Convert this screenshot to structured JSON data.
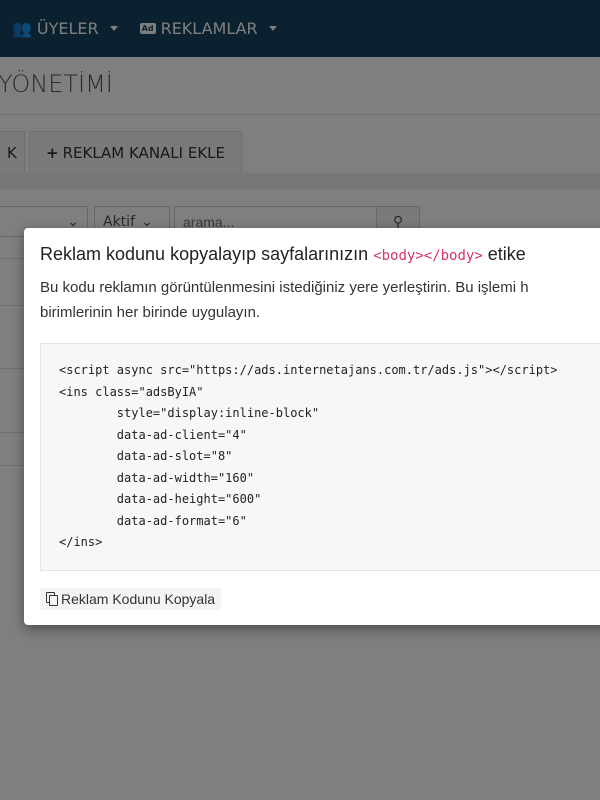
{
  "navbar": {
    "items": [
      {
        "label": "ÜYELER",
        "icon": "users-icon"
      },
      {
        "label": "REKLAMLAR",
        "icon": "ad-icon",
        "icon_text": "Ad"
      }
    ],
    "bg_color": "#17435f"
  },
  "page": {
    "title": "YÖNETİMİ",
    "tabs": [
      {
        "label": "K"
      },
      {
        "label": "REKLAM KANALI EKLE"
      }
    ],
    "filters": {
      "status_value": "Aktif",
      "search_placeholder": "arama..."
    }
  },
  "modal": {
    "title_prefix": "Reklam kodunu kopyalayıp sayfalarınızın",
    "title_code": "<body></body>",
    "title_suffix": "etike",
    "description_line1": "Bu kodu reklamın görüntülenmesini istediğiniz yere yerleştirin. Bu işlemi h",
    "description_line2": "birimlerinin her birinde uygulayın.",
    "code": "<script async src=\"https://ads.internetajans.com.tr/ads.js\"></script>\n<ins class=\"adsByIA\"\n        style=\"display:inline-block\"\n        data-ad-client=\"4\"\n        data-ad-slot=\"8\"\n        data-ad-width=\"160\"\n        data-ad-height=\"600\"\n        data-ad-format=\"6\"\n</ins>",
    "copy_button_label": "Reklam Kodunu Kopyala"
  }
}
